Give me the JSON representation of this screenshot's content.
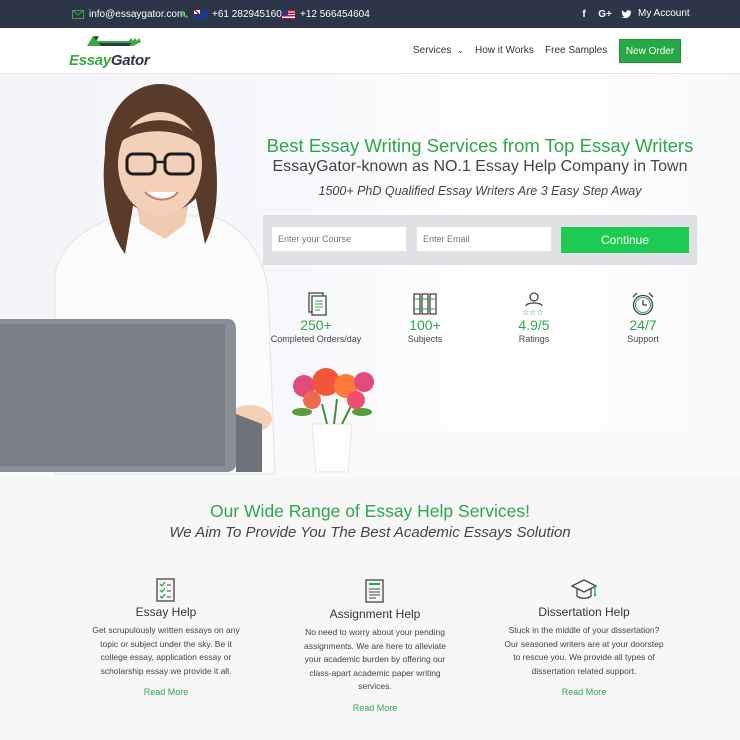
{
  "topbar": {
    "email": "info@essaygator.com",
    "phone_au": "+61 282945160",
    "phone_us": "+12 566454604",
    "social": [
      "f",
      "G+",
      "twitter"
    ],
    "account": "My Account"
  },
  "header": {
    "logo": "EssayGator",
    "nav": [
      "Services",
      "How it Works",
      "Free Samples"
    ],
    "order_button": "New Order"
  },
  "hero": {
    "title": "Best Essay Writing Services from Top Essay Writers",
    "subtitle": "EssayGator-known as NO.1 Essay Help Company in Town",
    "tagline": "1500+ PhD Qualified Essay Writers Are 3 Easy Step Away",
    "form": {
      "course_placeholder": "Enter your Course",
      "email_placeholder": "Enter Email",
      "continue": "Continue"
    },
    "stats": [
      {
        "value": "250+",
        "label": "Completed Orders/day",
        "icon": "orders-icon"
      },
      {
        "value": "100+",
        "label": "Subjects",
        "icon": "books-icon"
      },
      {
        "value": "4.9/5",
        "label": "Ratings",
        "icon": "rating-icon"
      },
      {
        "value": "24/7",
        "label": "Support",
        "icon": "clock-icon"
      }
    ]
  },
  "services": {
    "title": "Our Wide Range of Essay Help Services!",
    "subtitle": "We Aim To Provide You The Best Academic Essays Solution",
    "cards": [
      {
        "title": "Essay Help",
        "desc": "Get scrupulously written essays on any topic or subject under the sky. Be it college essay, application essay or scholarship essay we provide it all.",
        "link": "Read More",
        "icon": "checklist-icon"
      },
      {
        "title": "Assignment Help",
        "desc": "No need to worry about your pending assignments. We are here to alleviate your academic burden by offering our class-apart academic paper writing services.",
        "link": "Read More",
        "icon": "document-icon"
      },
      {
        "title": "Dissertation Help",
        "desc": "Stuck in the middle of your dissertation? Our seasoned writers are at your doorstep to rescue you. We provide all types of dissertation related support.",
        "link": "Read More",
        "icon": "graduation-cap-icon"
      }
    ]
  },
  "colors": {
    "brand_green": "#2fa64a",
    "topbar": "#2d3548",
    "button_green": "#1ecb52"
  }
}
